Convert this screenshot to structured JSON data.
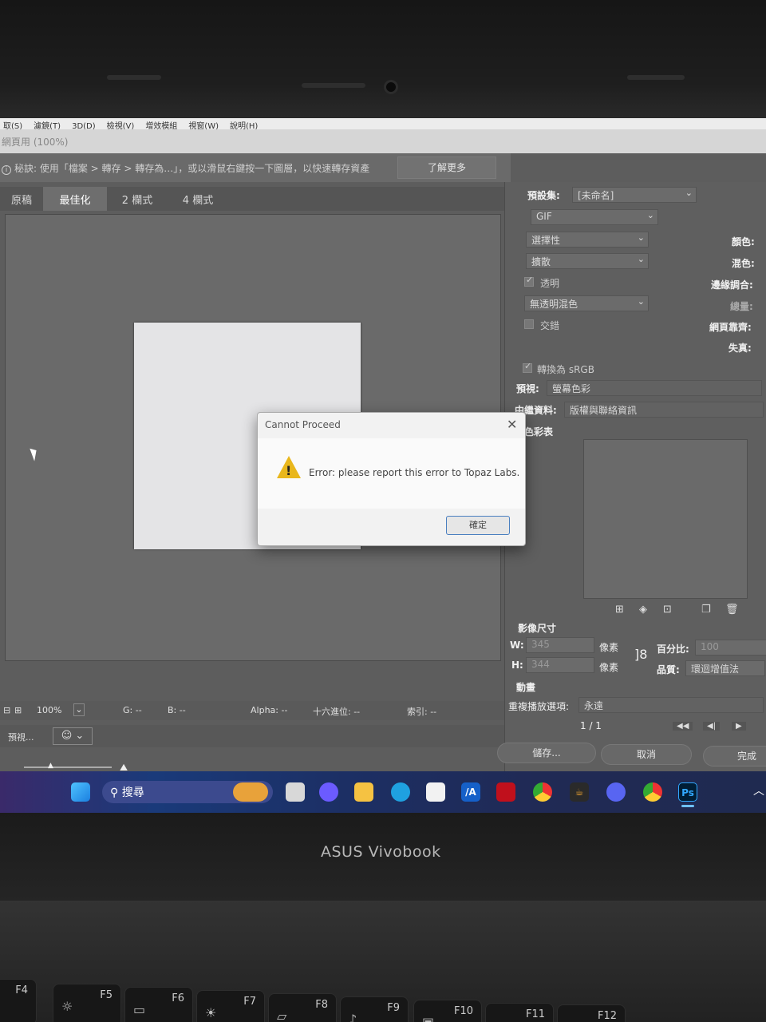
{
  "device": {
    "brand": "ASUS Vivobook"
  },
  "menu": [
    "取(S)",
    "濾鏡(T)",
    "3D(D)",
    "檢視(V)",
    "增效模組",
    "視窗(W)",
    "說明(H)"
  ],
  "doc_title": "網頁用 (100%)",
  "tip": {
    "text": "秘訣: 使用「檔案 > 轉存 > 轉存為…」，或以滑鼠右鍵按一下圖層，以快速轉存資產",
    "learn_more": "了解更多"
  },
  "tabs": [
    "原稿",
    "最佳化",
    "2 欄式",
    "4 欄式"
  ],
  "active_tab": "最佳化",
  "status": {
    "zoom": "100%",
    "g": "G: --",
    "b": "B: --",
    "alpha": "Alpha: --",
    "hex": "十六進位: --",
    "index": "索引: --"
  },
  "bottom": {
    "preview_label": "預視..."
  },
  "settings": {
    "preset_label": "預設集:",
    "preset_value": "[未命名]",
    "format": "GIF",
    "reduction": "選擇性",
    "dither": "擴散",
    "transparency_label": "透明",
    "matte": "無透明混色",
    "interlace_label": "交錯",
    "colors_label": "顏色:",
    "dither_amount_label": "混色:",
    "matte_label": "邊緣調合:",
    "amount_label": "總量:",
    "web_snap_label": "網頁靠齊:",
    "lossy_label": "失真:",
    "convert_srgb_label": "轉換為 sRGB",
    "preview_label": "預視:",
    "preview_value": "螢幕色彩",
    "metadata_label": "中繼資料:",
    "metadata_value": "版權與聯絡資訊",
    "color_table_label": "色彩表"
  },
  "image_size": {
    "title": "影像尺寸",
    "w_label": "W:",
    "w_value": "345",
    "w_unit": "像素",
    "h_label": "H:",
    "h_value": "344",
    "h_unit": "像素",
    "percent_label": "百分比:",
    "percent_value": "100",
    "quality_label": "品質:",
    "quality_value": "環迴增值法"
  },
  "animation": {
    "title": "動畫",
    "loop_label": "重複播放選項:",
    "loop_value": "永遠",
    "frame": "1 / 1"
  },
  "actions": {
    "save": "儲存...",
    "cancel": "取消",
    "done": "完成"
  },
  "dialog": {
    "title": "Cannot Proceed",
    "message": "Error: please report this error to Topaz Labs.",
    "ok": "確定"
  },
  "taskbar": {
    "search": "搜尋",
    "ps_label": "Ps",
    "ai_label": "/A"
  },
  "keys": [
    {
      "label": "F4"
    },
    {
      "label": "F5"
    },
    {
      "label": "F6"
    },
    {
      "label": "F7"
    },
    {
      "label": "F8"
    },
    {
      "label": "F9"
    },
    {
      "label": "F10"
    },
    {
      "label": "F11"
    },
    {
      "label": "F12"
    }
  ],
  "colors": {
    "warning": "#e9b71c",
    "ps_blue": "#31a8ff",
    "accent": "#4a7fc0"
  }
}
